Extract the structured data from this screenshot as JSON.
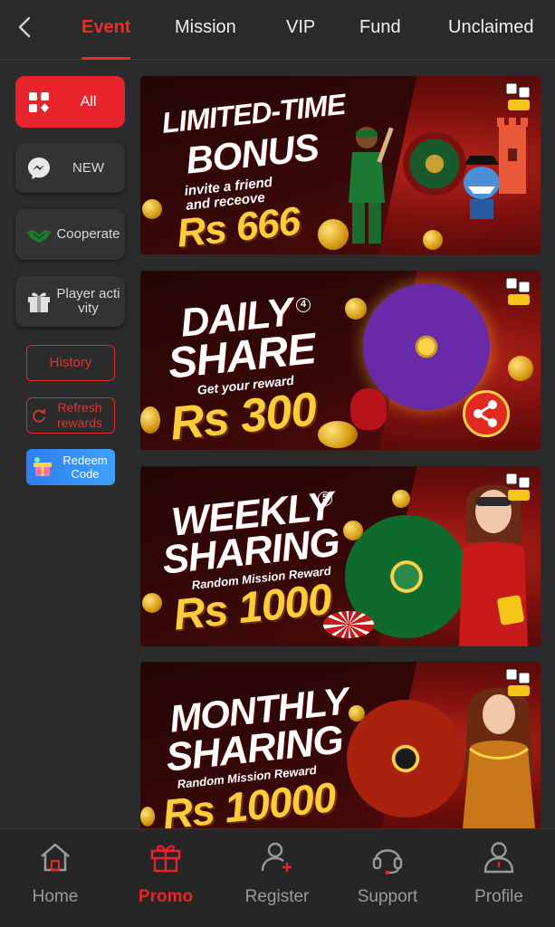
{
  "header": {
    "tabs": [
      {
        "label": "Event",
        "active": true
      },
      {
        "label": "Mission",
        "active": false
      },
      {
        "label": "VIP",
        "active": false
      },
      {
        "label": "Fund",
        "active": false
      },
      {
        "label": "Unclaimed",
        "active": false
      }
    ]
  },
  "sidebar": {
    "items": [
      {
        "label": "All",
        "icon": "grid-icon",
        "active": true
      },
      {
        "label": "NEW",
        "icon": "messenger-icon",
        "active": false
      },
      {
        "label": "Cooperate",
        "icon": "handshake-icon",
        "active": false
      },
      {
        "label": "Player activity",
        "icon": "gift-icon",
        "active": false
      }
    ],
    "history_label": "History",
    "refresh_label": "Refresh rewards",
    "redeem_label": "Redeem Code"
  },
  "banners": [
    {
      "title_1": "LIMITED-TIME",
      "title_2": "BONUS",
      "subtitle": "invite a friend and receove",
      "amount": "Rs 666",
      "badge_number": ""
    },
    {
      "title_1": "DAILY",
      "title_2": "SHARE",
      "subtitle": "Get your reward",
      "amount": "Rs 300",
      "badge_number": "4"
    },
    {
      "title_1": "WEEKLY",
      "title_2": "SHARING",
      "subtitle": "Random Mission Reward",
      "amount": "Rs 1000",
      "badge_number": "5"
    },
    {
      "title_1": "MONTHLY",
      "title_2": "SHARING",
      "subtitle": "Random Mission Reward",
      "amount": "Rs 10000",
      "badge_number": ""
    }
  ],
  "bottom_nav": [
    {
      "label": "Home",
      "icon": "home-icon",
      "active": false
    },
    {
      "label": "Promo",
      "icon": "gift-icon",
      "active": true
    },
    {
      "label": "Register",
      "icon": "add-user-icon",
      "active": false
    },
    {
      "label": "Support",
      "icon": "headset-icon",
      "active": false
    },
    {
      "label": "Profile",
      "icon": "user-icon",
      "active": false
    }
  ],
  "colors": {
    "accent": "#e8232b",
    "background": "#2b2b2b",
    "gold": "#ffcc3a"
  }
}
